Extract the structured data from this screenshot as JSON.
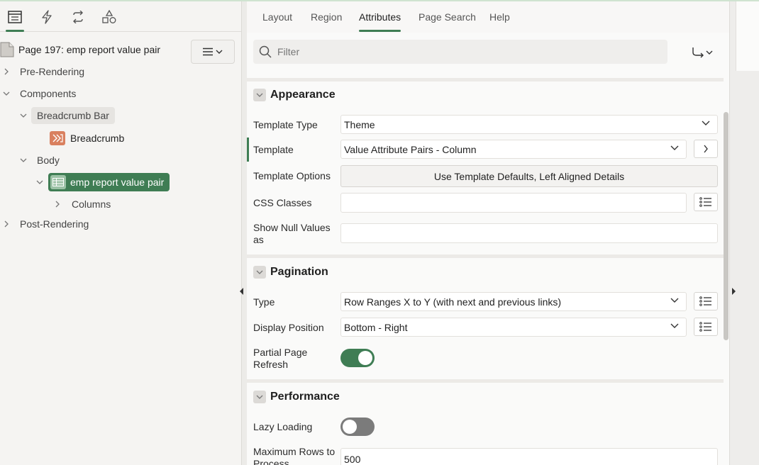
{
  "left_panel": {
    "tabs": [
      {
        "icon": "rendering-tree-icon",
        "active": true
      },
      {
        "icon": "lightning-icon"
      },
      {
        "icon": "processing-loop-icon"
      },
      {
        "icon": "shared-components-icon"
      }
    ],
    "page_title": "Page 197: emp report value pair",
    "tree": {
      "pre_rendering": "Pre-Rendering",
      "components": "Components",
      "breadcrumb_bar": "Breadcrumb Bar",
      "breadcrumb": "Breadcrumb",
      "body": "Body",
      "region": "emp report value pair",
      "columns": "Columns",
      "post_rendering": "Post-Rendering"
    }
  },
  "right_panel": {
    "tabs": [
      "Layout",
      "Region",
      "Attributes",
      "Page Search",
      "Help"
    ],
    "active_tab": "Attributes",
    "filter_placeholder": "Filter",
    "sections": {
      "appearance": {
        "title": "Appearance",
        "template_type_label": "Template Type",
        "template_type_value": "Theme",
        "template_label": "Template",
        "template_value": "Value Attribute Pairs - Column",
        "template_options_label": "Template Options",
        "template_options_value": "Use Template Defaults, Left Aligned Details",
        "css_classes_label": "CSS Classes",
        "css_classes_value": "",
        "show_null_label": "Show Null Values as",
        "show_null_value": ""
      },
      "pagination": {
        "title": "Pagination",
        "type_label": "Type",
        "type_value": "Row Ranges X to Y (with next and previous links)",
        "display_position_label": "Display Position",
        "display_position_value": "Bottom - Right",
        "partial_refresh_label": "Partial Page Refresh",
        "partial_refresh_on": true
      },
      "performance": {
        "title": "Performance",
        "lazy_loading_label": "Lazy Loading",
        "lazy_loading_on": false,
        "max_rows_label": "Maximum Rows to Process",
        "max_rows_value": "500"
      }
    }
  },
  "colors": {
    "accent_green": "#3f7d54",
    "breadcrumb_icon": "#d9805f"
  }
}
